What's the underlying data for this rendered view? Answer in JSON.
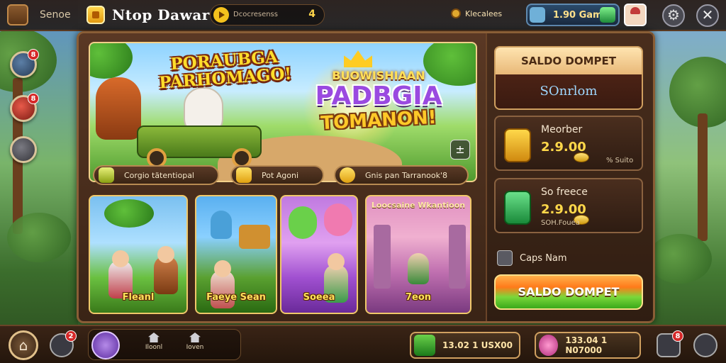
{
  "topbar": {
    "search_label": "Senoe",
    "app_title": "Ntop Dawar",
    "field_text": "Dcocresenss",
    "field_number": "4",
    "gold_status": "Klecalees",
    "balance": "1.90 Gam",
    "close_symbol": "✕"
  },
  "side": {
    "badge1": "8",
    "badge2": "8",
    "bottom_badge_left": "2",
    "bottom_badge_right": "8"
  },
  "banner": {
    "title_left": "PORAUBGA PARHOMAGO!",
    "title_right_1": "BUOWISHIAAN",
    "title_right_2": "PADBGIA",
    "title_right_3": "TOMANON!",
    "share_symbol": "±"
  },
  "features": [
    {
      "label": "Corgio tätentiopal"
    },
    {
      "label": "Pot Agoni"
    },
    {
      "label": "Gnis pan Tarranook'8"
    }
  ],
  "tiles": [
    {
      "label": "Fleanl",
      "top_label": ""
    },
    {
      "label": "Faeye Sean",
      "top_label": ""
    },
    {
      "label": "Soeea",
      "top_label": ""
    },
    {
      "label": "7eon",
      "top_label": "Loocsaine Wkantioon"
    }
  ],
  "right": {
    "saldo_title": "SALDO DOMPET",
    "saldo_value": "SOnrlom",
    "stat1_label": "Meorber",
    "stat1_value": "2.9.00",
    "stat1_sub": "% Suito",
    "stat2_label": "So freece",
    "stat2_value": "2.9.00",
    "stat2_sub": "SOH.Fouea",
    "caps_label": "Caps Nam",
    "cta_label": "SALDO DOMPET"
  },
  "bottombar": {
    "home_symbol": "⌂",
    "nav1": "Iloonl",
    "nav2": "Ioven",
    "pill1_text": "13.02 1 USX00",
    "pill2_text": "133.04 1 N07000"
  },
  "colors": {
    "accent_gold": "#ffd54a",
    "panel_brown": "#5a3824",
    "cta_green": "#3aa81a",
    "cta_orange": "#ff7a1a"
  }
}
